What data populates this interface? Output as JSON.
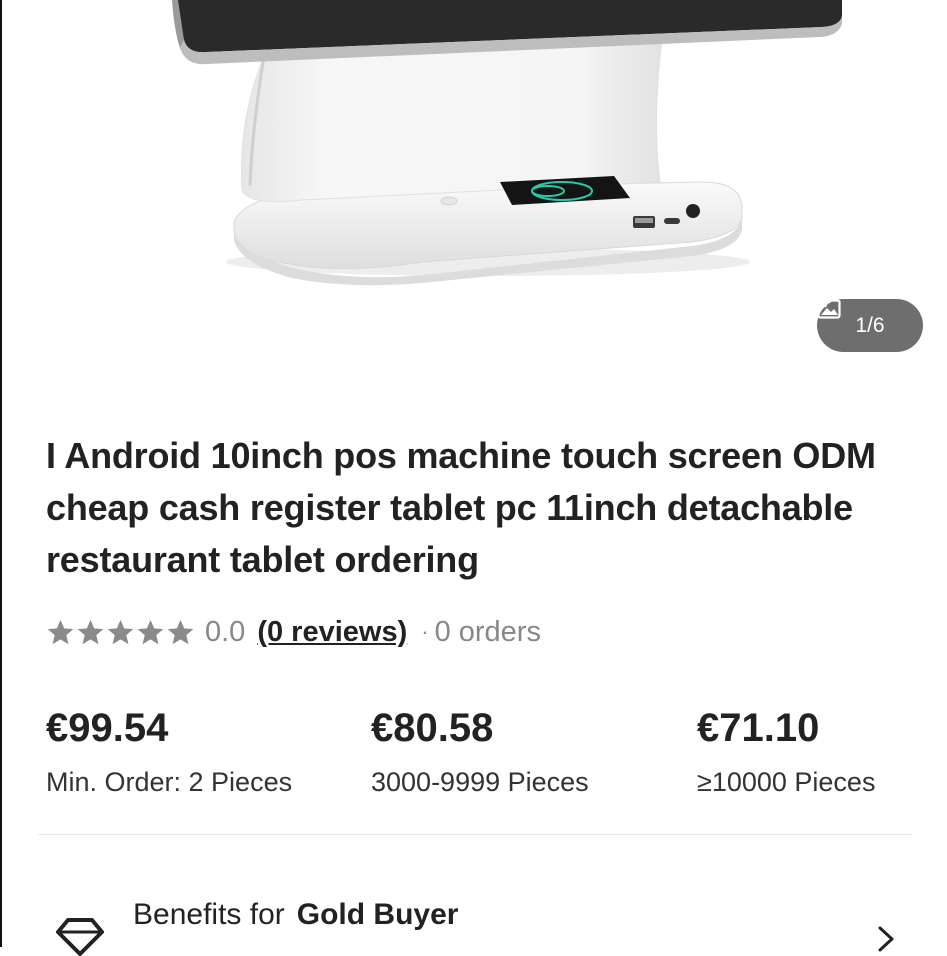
{
  "gallery": {
    "counter": "1/6",
    "icon": "image-icon"
  },
  "product": {
    "title": "I Android 10inch pos machine touch screen ODM cheap cash register tablet pc 11inch detachable restaurant tablet ordering"
  },
  "rating": {
    "stars": 0,
    "value": "0.0",
    "reviews": "(0 reviews)",
    "separator": "·",
    "orders": "0 orders"
  },
  "pricing": [
    {
      "price": "€99.54",
      "quantity": "Min. Order: 2 Pieces"
    },
    {
      "price": "€80.58",
      "quantity": "3000-9999 Pieces"
    },
    {
      "price": "€71.10",
      "quantity": "≥10000 Pieces"
    }
  ],
  "benefits": {
    "prefix": "Benefits for",
    "tier": "Gold Buyer",
    "icon": "diamond-icon",
    "chevron": "chevron-right-icon"
  },
  "colors": {
    "star_inactive": "#8a8a8a",
    "counter_bg": "#6e6e6e",
    "text_primary": "#222222",
    "text_muted": "#888888"
  }
}
